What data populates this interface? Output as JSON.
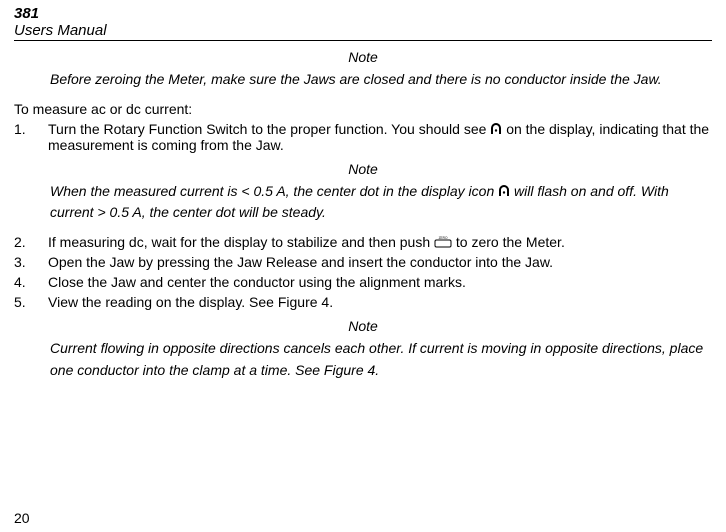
{
  "header": {
    "model": "381",
    "manual": "Users Manual"
  },
  "notes": {
    "label": "Note",
    "before_zero": "Before zeroing the Meter, make sure the Jaws are closed and there is no conductor inside the Jaw.",
    "flash_a": "When the measured current is < 0.5 A, the center dot in the display icon ",
    "flash_b": " will flash on and off. With current > 0.5 A, the center dot will be steady.",
    "cancel": "Current flowing in opposite directions cancels each other. If current is moving in opposite directions, place one conductor into the clamp at a time. See Figure 4."
  },
  "intro": "To measure ac or dc current:",
  "steps": {
    "s1a": "Turn the Rotary Function Switch to the proper function. You should see ",
    "s1b": " on the display, indicating that the measurement is coming from the Jaw.",
    "s2a": "If measuring dc, wait for the display to stabilize and then push ",
    "s2b": " to zero the Meter.",
    "s3": "Open the Jaw by pressing the Jaw Release and insert the conductor into the Jaw.",
    "s4": "Close the Jaw and center the conductor using the alignment marks.",
    "s5": "View the reading on the display. See Figure 4."
  },
  "nums": {
    "n1": "1.",
    "n2": "2.",
    "n3": "3.",
    "n4": "4.",
    "n5": "5."
  },
  "page_number": "20",
  "icons": {
    "jaw": "jaw-icon",
    "zero": "zero-button-icon"
  }
}
